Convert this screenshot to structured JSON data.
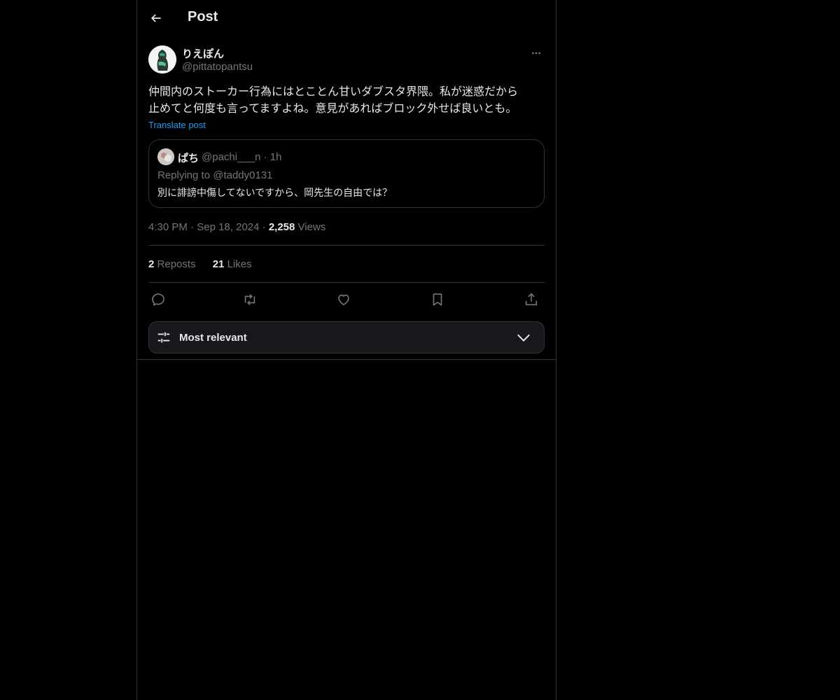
{
  "header": {
    "title": "Post",
    "back_icon": "arrow-left-icon"
  },
  "post": {
    "author": {
      "display_name": "りえぽん",
      "handle": "@pittatopantsu"
    },
    "text_lines": [
      "仲間内のストーカー行為にはとことん甘いダブスタ界隈。私が迷惑だから",
      "止めてと何度も言ってますよね。意見があればブロック外せば良いとも。"
    ],
    "translate_label": "Translate post",
    "quote": {
      "display_name": "ぱち",
      "meta": "@pachi___n · 1h",
      "replying_to": "Replying to @taddy0131",
      "text": "別に誹謗中傷してないですから、岡先生の自由では？"
    },
    "time": "4:30 PM",
    "date": "Sep 18, 2024",
    "views_count": "2,258",
    "views_label": "Views",
    "reposts_count": "2",
    "reposts_label": "Reposts",
    "likes_count": "21",
    "likes_label": "Likes"
  },
  "actions": [
    {
      "name": "reply",
      "icon": "reply-icon"
    },
    {
      "name": "repost",
      "icon": "repost-icon"
    },
    {
      "name": "like",
      "icon": "heart-icon"
    },
    {
      "name": "bookmark",
      "icon": "bookmark-icon"
    },
    {
      "name": "share",
      "icon": "share-icon"
    }
  ],
  "sort": {
    "label": "Most relevant",
    "icon": "sliders-icon"
  },
  "colors": {
    "background": "#000000",
    "text": "#e7e9ea",
    "muted": "#71767b",
    "link": "#1d9bf0",
    "border": "#2f3336"
  }
}
